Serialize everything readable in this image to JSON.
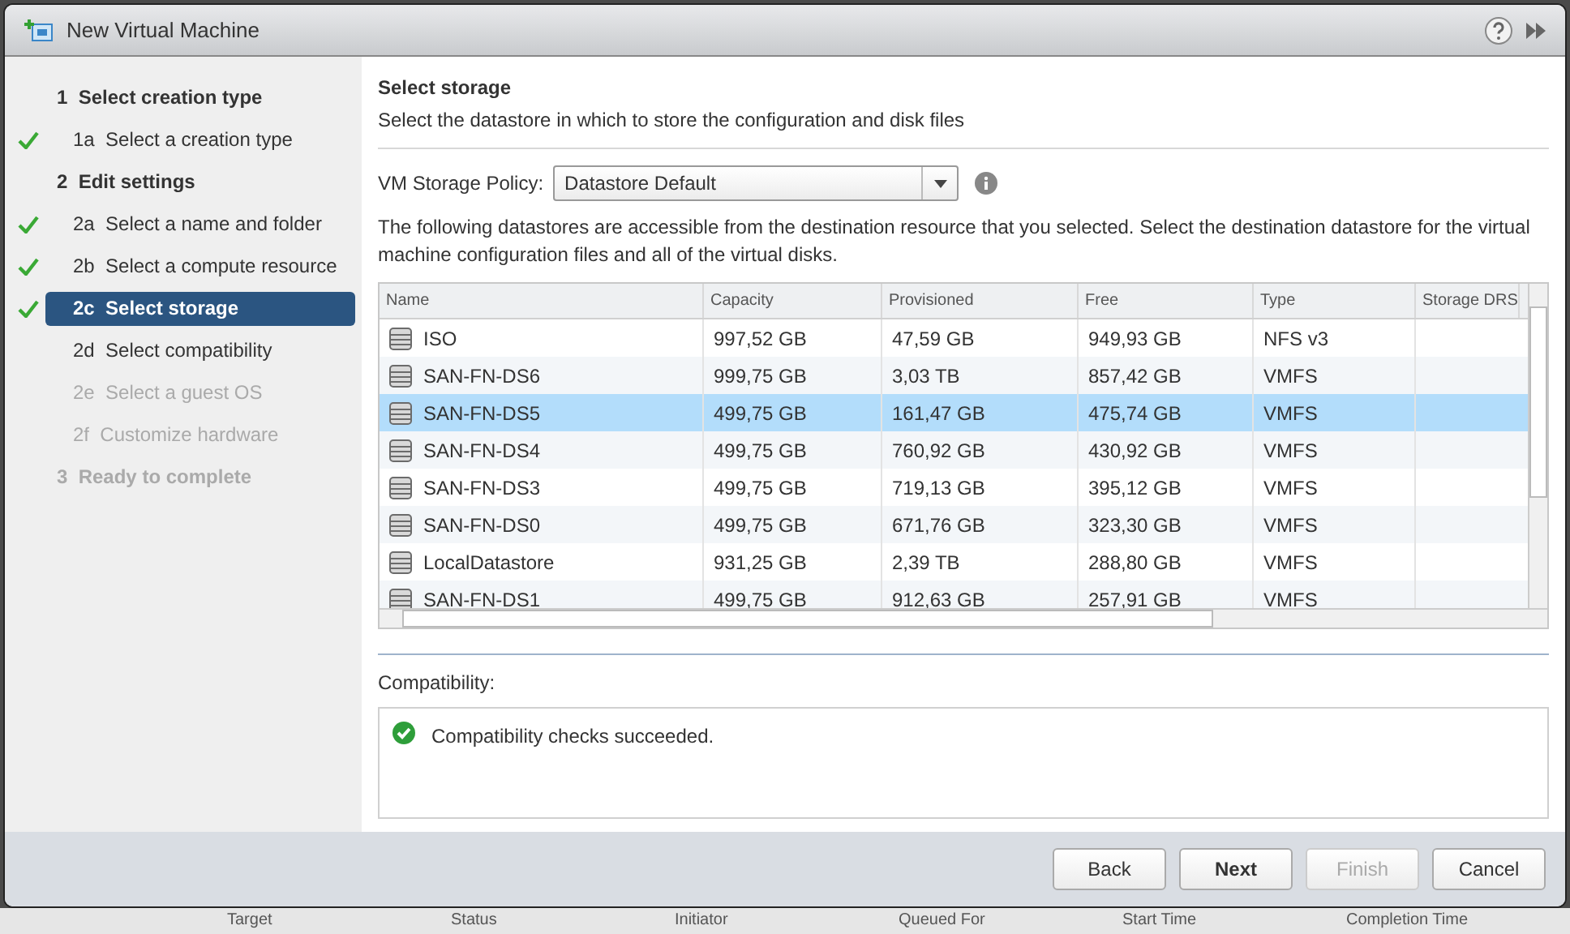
{
  "window": {
    "title": "New Virtual Machine"
  },
  "steps": [
    {
      "label": "1  Select creation type",
      "disabled": false,
      "children": [
        {
          "label": "1a  Select a creation type",
          "done": true,
          "selected": false,
          "disabled": false
        }
      ]
    },
    {
      "label": "2  Edit settings",
      "disabled": false,
      "children": [
        {
          "label": "2a  Select a name and folder",
          "done": true,
          "selected": false,
          "disabled": false
        },
        {
          "label": "2b  Select a compute resource",
          "done": true,
          "selected": false,
          "disabled": false
        },
        {
          "label": "2c  Select storage",
          "done": true,
          "selected": true,
          "disabled": false
        },
        {
          "label": "2d  Select compatibility",
          "done": false,
          "selected": false,
          "disabled": false
        },
        {
          "label": "2e  Select a guest OS",
          "done": false,
          "selected": false,
          "disabled": true
        },
        {
          "label": "2f  Customize hardware",
          "done": false,
          "selected": false,
          "disabled": true
        }
      ]
    },
    {
      "label": "3  Ready to complete",
      "disabled": true
    }
  ],
  "page": {
    "title": "Select storage",
    "subtitle": "Select the datastore in which to store the configuration and disk files"
  },
  "policy": {
    "label": "VM Storage Policy:",
    "value": "Datastore Default"
  },
  "description": "The following datastores are accessible from the destination resource that you selected. Select the destination datastore for the virtual machine configuration files and all of the virtual disks.",
  "table": {
    "columns": [
      "Name",
      "Capacity",
      "Provisioned",
      "Free",
      "Type",
      "Storage DRS"
    ],
    "rows": [
      {
        "cells": [
          "ISO",
          "997,52 GB",
          "47,59 GB",
          "949,93 GB",
          "NFS v3"
        ],
        "selected": false
      },
      {
        "cells": [
          "SAN-FN-DS6",
          "999,75 GB",
          "3,03 TB",
          "857,42 GB",
          "VMFS"
        ],
        "selected": false
      },
      {
        "cells": [
          "SAN-FN-DS5",
          "499,75 GB",
          "161,47 GB",
          "475,74 GB",
          "VMFS"
        ],
        "selected": true
      },
      {
        "cells": [
          "SAN-FN-DS4",
          "499,75 GB",
          "760,92 GB",
          "430,92 GB",
          "VMFS"
        ],
        "selected": false
      },
      {
        "cells": [
          "SAN-FN-DS3",
          "499,75 GB",
          "719,13 GB",
          "395,12 GB",
          "VMFS"
        ],
        "selected": false
      },
      {
        "cells": [
          "SAN-FN-DS0",
          "499,75 GB",
          "671,76 GB",
          "323,30 GB",
          "VMFS"
        ],
        "selected": false
      },
      {
        "cells": [
          "LocalDatastore",
          "931,25 GB",
          "2,39 TB",
          "288,80 GB",
          "VMFS"
        ],
        "selected": false
      },
      {
        "cells": [
          "SAN-FN-DS1",
          "499,75 GB",
          "912,63 GB",
          "257,91 GB",
          "VMFS"
        ],
        "selected": false
      }
    ]
  },
  "compatibility": {
    "label": "Compatibility:",
    "message": "Compatibility checks succeeded."
  },
  "buttons": [
    {
      "label": "Back",
      "default": false,
      "disabled": false
    },
    {
      "label": "Next",
      "default": true,
      "disabled": false
    },
    {
      "label": "Finish",
      "default": false,
      "disabled": true
    },
    {
      "label": "Cancel",
      "default": false,
      "disabled": false
    }
  ],
  "background_columns": [
    "Target",
    "Status",
    "Initiator",
    "Queued For",
    "Start Time",
    "Completion Time"
  ]
}
